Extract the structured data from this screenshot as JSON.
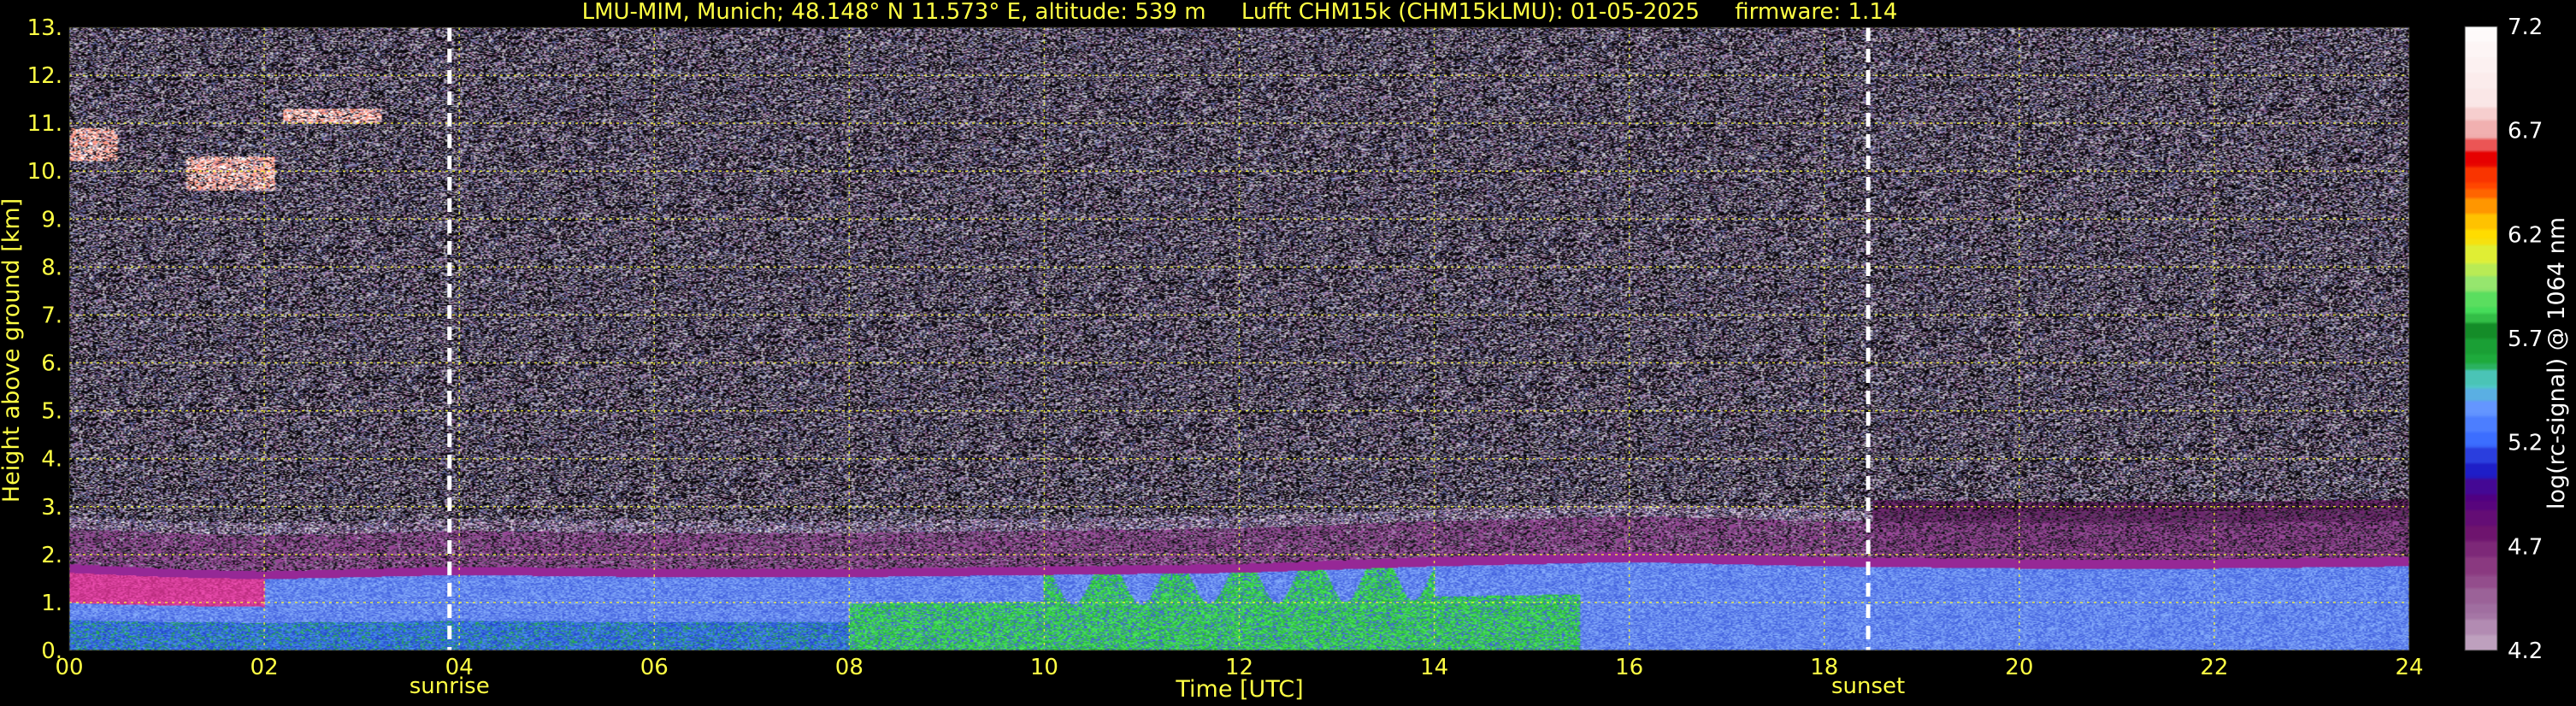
{
  "chart_data": {
    "type": "heatmap",
    "title": "LMU-MIM, Munich; 48.148° N 11.573° E, altitude: 539 m     Lufft CHM15k (CHM15kLMU): 01-05-2025     firmware: 1.14",
    "xlabel": "Time [UTC]",
    "ylabel": "Height above ground [km]",
    "xlim": [
      0,
      24
    ],
    "ylim": [
      0,
      13
    ],
    "x_ticks": [
      "00",
      "02",
      "04",
      "06",
      "08",
      "10",
      "12",
      "14",
      "16",
      "18",
      "20",
      "22",
      "24"
    ],
    "y_ticks": [
      "0.",
      "1.",
      "2.",
      "3.",
      "4.",
      "5.",
      "6.",
      "7.",
      "8.",
      "9.",
      "10.",
      "11.",
      "12.",
      "13."
    ],
    "grid": true,
    "colorbar": {
      "label": "log(rc-signal) @ 1064 nm",
      "range": [
        4.2,
        7.2
      ],
      "ticks": [
        "4.2",
        "4.7",
        "5.2",
        "5.7",
        "6.2",
        "6.7",
        "7.2"
      ]
    },
    "annotations": [
      {
        "label": "sunrise",
        "x": 3.9
      },
      {
        "label": "sunset",
        "x": 18.45
      }
    ],
    "features": {
      "boundary_layer_top_km": [
        [
          0,
          1.8
        ],
        [
          1,
          1.7
        ],
        [
          2,
          1.65
        ],
        [
          3,
          1.7
        ],
        [
          4,
          1.75
        ],
        [
          6,
          1.7
        ],
        [
          8,
          1.7
        ],
        [
          10,
          1.75
        ],
        [
          12,
          1.8
        ],
        [
          14,
          1.95
        ],
        [
          16,
          2.05
        ],
        [
          18,
          1.95
        ],
        [
          20,
          1.9
        ],
        [
          22,
          1.9
        ],
        [
          24,
          1.95
        ]
      ],
      "clouds": [
        {
          "x": [
            0.0,
            0.5
          ],
          "y": [
            10.2,
            10.9
          ]
        },
        {
          "x": [
            1.2,
            2.1
          ],
          "y": [
            9.6,
            10.3
          ]
        },
        {
          "x": [
            2.2,
            3.2
          ],
          "y": [
            11.0,
            11.3
          ]
        }
      ]
    }
  }
}
